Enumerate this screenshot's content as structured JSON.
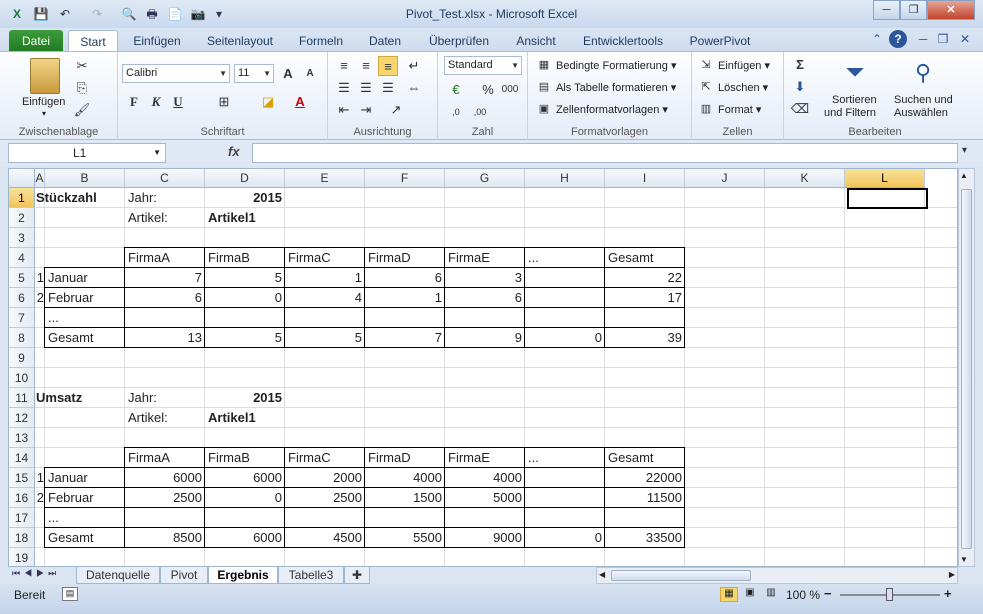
{
  "window": {
    "title": "Pivot_Test.xlsx - Microsoft Excel",
    "minimize": "─",
    "restore": "❐",
    "close": "✕"
  },
  "qat": {
    "save": "💾",
    "undo": "↶",
    "redo": "↷",
    "preview": "🔍",
    "print": "🖶",
    "new": "📄",
    "camera": "📷",
    "more": "▾"
  },
  "tabs": [
    "Datei",
    "Start",
    "Einfügen",
    "Seitenlayout",
    "Formeln",
    "Daten",
    "Überprüfen",
    "Ansicht",
    "Entwicklertools",
    "PowerPivot"
  ],
  "tab_icons": {
    "collapse": "⌃",
    "help": "?",
    "min": "─",
    "restore": "❐",
    "close": "✕"
  },
  "ribbon": {
    "clipboard": {
      "label": "Zwischenablage",
      "paste": "Einfügen"
    },
    "font": {
      "label": "Schriftart",
      "name": "Calibri",
      "size": "11",
      "bold": "F",
      "italic": "K",
      "underline": "U",
      "grow": "A",
      "shrink": "A",
      "color_a": "A"
    },
    "alignment": {
      "label": "Ausrichtung"
    },
    "number": {
      "label": "Zahl",
      "format": "Standard",
      "percent": "%",
      "thousands": "000",
      "inc": ",0",
      "dec": ",00"
    },
    "styles": {
      "label": "Formatvorlagen",
      "cond": "Bedingte Formatierung",
      "table": "Als Tabelle formatieren",
      "cellstyles": "Zellenformatvorlagen"
    },
    "cells": {
      "label": "Zellen",
      "insert": "Einfügen",
      "delete": "Löschen",
      "format": "Format"
    },
    "editing": {
      "label": "Bearbeiten",
      "sum": "Σ",
      "sort1": "Sortieren",
      "sort2": "und Filtern",
      "find1": "Suchen und",
      "find2": "Auswählen"
    }
  },
  "formula": {
    "namebox": "L1",
    "fx": "fx",
    "value": ""
  },
  "columns": [
    "A",
    "B",
    "C",
    "D",
    "E",
    "F",
    "G",
    "H",
    "I",
    "J",
    "K",
    "L"
  ],
  "rows": [
    "1",
    "2",
    "3",
    "4",
    "5",
    "6",
    "7",
    "8",
    "9",
    "10",
    "11",
    "12",
    "13",
    "14",
    "15",
    "16",
    "17",
    "18",
    "19"
  ],
  "cells": {
    "A1": "Stückzahl",
    "C1": "Jahr:",
    "D1": "2015",
    "C2": "Artikel:",
    "D2": "Artikel1",
    "C4": "FirmaA",
    "D4": "FirmaB",
    "E4": "FirmaC",
    "F4": "FirmaD",
    "G4": "FirmaE",
    "H4": "...",
    "I4": "Gesamt",
    "A5": "1",
    "B5": "Januar",
    "C5": "7",
    "D5": "5",
    "E5": "1",
    "F5": "6",
    "G5": "3",
    "I5": "22",
    "A6": "2",
    "B6": "Februar",
    "C6": "6",
    "D6": "0",
    "E6": "4",
    "F6": "1",
    "G6": "6",
    "I6": "17",
    "B7": "...",
    "B8": "Gesamt",
    "C8": "13",
    "D8": "5",
    "E8": "5",
    "F8": "7",
    "G8": "9",
    "H8": "0",
    "I8": "39",
    "A11": "Umsatz",
    "C11": "Jahr:",
    "D11": "2015",
    "C12": "Artikel:",
    "D12": "Artikel1",
    "C14": "FirmaA",
    "D14": "FirmaB",
    "E14": "FirmaC",
    "F14": "FirmaD",
    "G14": "FirmaE",
    "H14": "...",
    "I14": "Gesamt",
    "A15": "1",
    "B15": "Januar",
    "C15": "6000",
    "D15": "6000",
    "E15": "2000",
    "F15": "4000",
    "G15": "4000",
    "I15": "22000",
    "A16": "2",
    "B16": "Februar",
    "C16": "2500",
    "D16": "0",
    "E16": "2500",
    "F16": "1500",
    "G16": "5000",
    "I16": "11500",
    "B17": "...",
    "B18": "Gesamt",
    "C18": "8500",
    "D18": "6000",
    "E18": "4500",
    "F18": "5500",
    "G18": "9000",
    "H18": "0",
    "I18": "33500"
  },
  "sheet_tabs": [
    "Datenquelle",
    "Pivot",
    "Ergebnis",
    "Tabelle3"
  ],
  "active_sheet": "Ergebnis",
  "status": {
    "mode": "Bereit",
    "zoom": "100 %",
    "minus": "−",
    "plus": "+"
  },
  "colors": {
    "accent": "#2b579a",
    "datei_tab": "#1f7a1f",
    "selected_header": "#f2c45a"
  }
}
